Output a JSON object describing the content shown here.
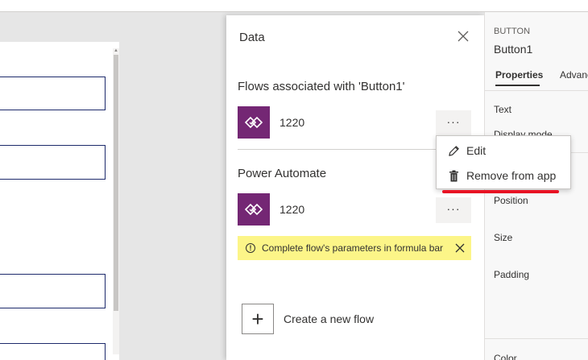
{
  "data_panel": {
    "title": "Data",
    "flows_section_title": "Flows associated with 'Button1'",
    "associated_flow": {
      "name": "1220",
      "more_label": "···"
    },
    "power_automate_title": "Power Automate",
    "pa_flow": {
      "name": "1220",
      "more_label": "···"
    },
    "warning_text": "Complete flow's parameters in formula bar",
    "create_label": "Create a new flow",
    "create_symbol": "+"
  },
  "context_menu": {
    "items": [
      {
        "label": "Edit",
        "icon": "pencil-icon"
      },
      {
        "label": "Remove from app",
        "icon": "trash-icon"
      }
    ]
  },
  "properties": {
    "control_type": "BUTTON",
    "control_name": "Button1",
    "tabs": [
      "Properties",
      "Advanced"
    ],
    "rows": [
      "Text",
      "Display mode",
      "Position",
      "Size",
      "Padding",
      "Color"
    ]
  },
  "colors": {
    "flow_icon_bg": "#742774",
    "warning_bg": "#fcf588",
    "highlight": "#e81123"
  }
}
